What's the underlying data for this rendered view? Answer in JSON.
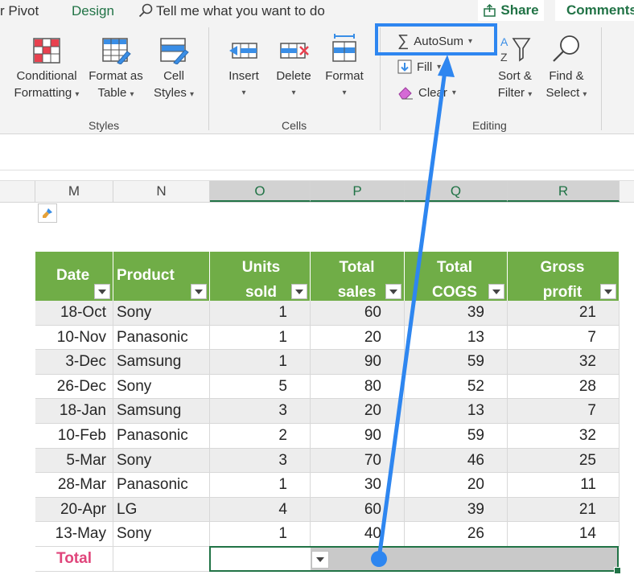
{
  "tabs": {
    "pivot": "r Pivot",
    "design": "Design",
    "tell_me": "Tell me what you want to do"
  },
  "share": "Share",
  "comments": "Comments",
  "ribbon": {
    "conditional_formatting": [
      "Conditional",
      "Formatting"
    ],
    "format_as_table": [
      "Format as",
      "Table"
    ],
    "cell_styles": [
      "Cell",
      "Styles"
    ],
    "styles_group": "Styles",
    "insert": "Insert",
    "delete": "Delete",
    "format": "Format",
    "cells_group": "Cells",
    "autosum": "AutoSum",
    "fill": "Fill",
    "clear": "Clear",
    "sort_filter": [
      "Sort &",
      "Filter"
    ],
    "find_select": [
      "Find &",
      "Select"
    ],
    "editing_group": "Editing"
  },
  "columns": [
    "M",
    "N",
    "O",
    "P",
    "Q",
    "R"
  ],
  "table": {
    "headers": [
      [
        "Date"
      ],
      [
        "Product"
      ],
      [
        "Units",
        "sold"
      ],
      [
        "Total",
        "sales"
      ],
      [
        "Total",
        "COGS"
      ],
      [
        "Gross",
        "profit"
      ]
    ],
    "rows": [
      [
        "18-Oct",
        "Sony",
        "1",
        "60",
        "39",
        "21"
      ],
      [
        "10-Nov",
        "Panasonic",
        "1",
        "20",
        "13",
        "7"
      ],
      [
        "3-Dec",
        "Samsung",
        "1",
        "90",
        "59",
        "32"
      ],
      [
        "26-Dec",
        "Sony",
        "5",
        "80",
        "52",
        "28"
      ],
      [
        "18-Jan",
        "Samsung",
        "3",
        "20",
        "13",
        "7"
      ],
      [
        "10-Feb",
        "Panasonic",
        "2",
        "90",
        "59",
        "32"
      ],
      [
        "5-Mar",
        "Sony",
        "3",
        "70",
        "46",
        "25"
      ],
      [
        "28-Mar",
        "Panasonic",
        "1",
        "30",
        "20",
        "11"
      ],
      [
        "20-Apr",
        "LG",
        "4",
        "60",
        "39",
        "21"
      ],
      [
        "13-May",
        "Sony",
        "1",
        "40",
        "26",
        "14"
      ]
    ],
    "total_label": "Total"
  },
  "colors": {
    "header_green": "#70ad47",
    "excel_green": "#217346",
    "total_pink": "#e0457b",
    "highlight_blue": "#2e86f0",
    "band": "#ededed"
  }
}
